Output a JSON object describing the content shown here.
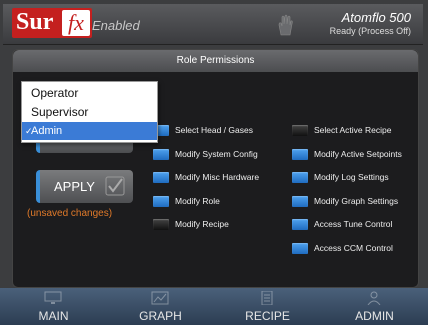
{
  "header": {
    "logo_sur": "Sur",
    "logo_fx": "fx",
    "enabled_label": "Enabled",
    "device_name": "Atomflo 500",
    "device_status": "Ready (Process Off)"
  },
  "panel": {
    "title": "Role Permissions"
  },
  "role_dropdown": {
    "options": [
      "Operator",
      "Supervisor",
      "Admin"
    ],
    "selected": "Admin"
  },
  "apply": {
    "label": "APPLY",
    "unsaved_note": "(unsaved changes)"
  },
  "permissions_left": [
    {
      "label": "Select Head / Gases",
      "checked": true
    },
    {
      "label": "Modify System Config",
      "checked": true
    },
    {
      "label": "Modify Misc Hardware",
      "checked": true
    },
    {
      "label": "Modify Role",
      "checked": true
    },
    {
      "label": "Modify Recipe",
      "checked": false
    }
  ],
  "permissions_right": [
    {
      "label": "Select Active Recipe",
      "checked": false
    },
    {
      "label": "Modify Active Setpoints",
      "checked": true
    },
    {
      "label": "Modify Log Settings",
      "checked": true
    },
    {
      "label": "Modify Graph Settings",
      "checked": true
    },
    {
      "label": "Access Tune Control",
      "checked": true
    },
    {
      "label": "Access CCM Control",
      "checked": true
    }
  ],
  "nav": {
    "main": "MAIN",
    "graph": "GRAPH",
    "recipe": "RECIPE",
    "admin": "ADMIN"
  },
  "colors": {
    "brand_red": "#c4201f",
    "checkbox_blue": "#2f86d8",
    "unsaved_orange": "#e07a2a",
    "selection_blue": "#3b7bd6"
  }
}
